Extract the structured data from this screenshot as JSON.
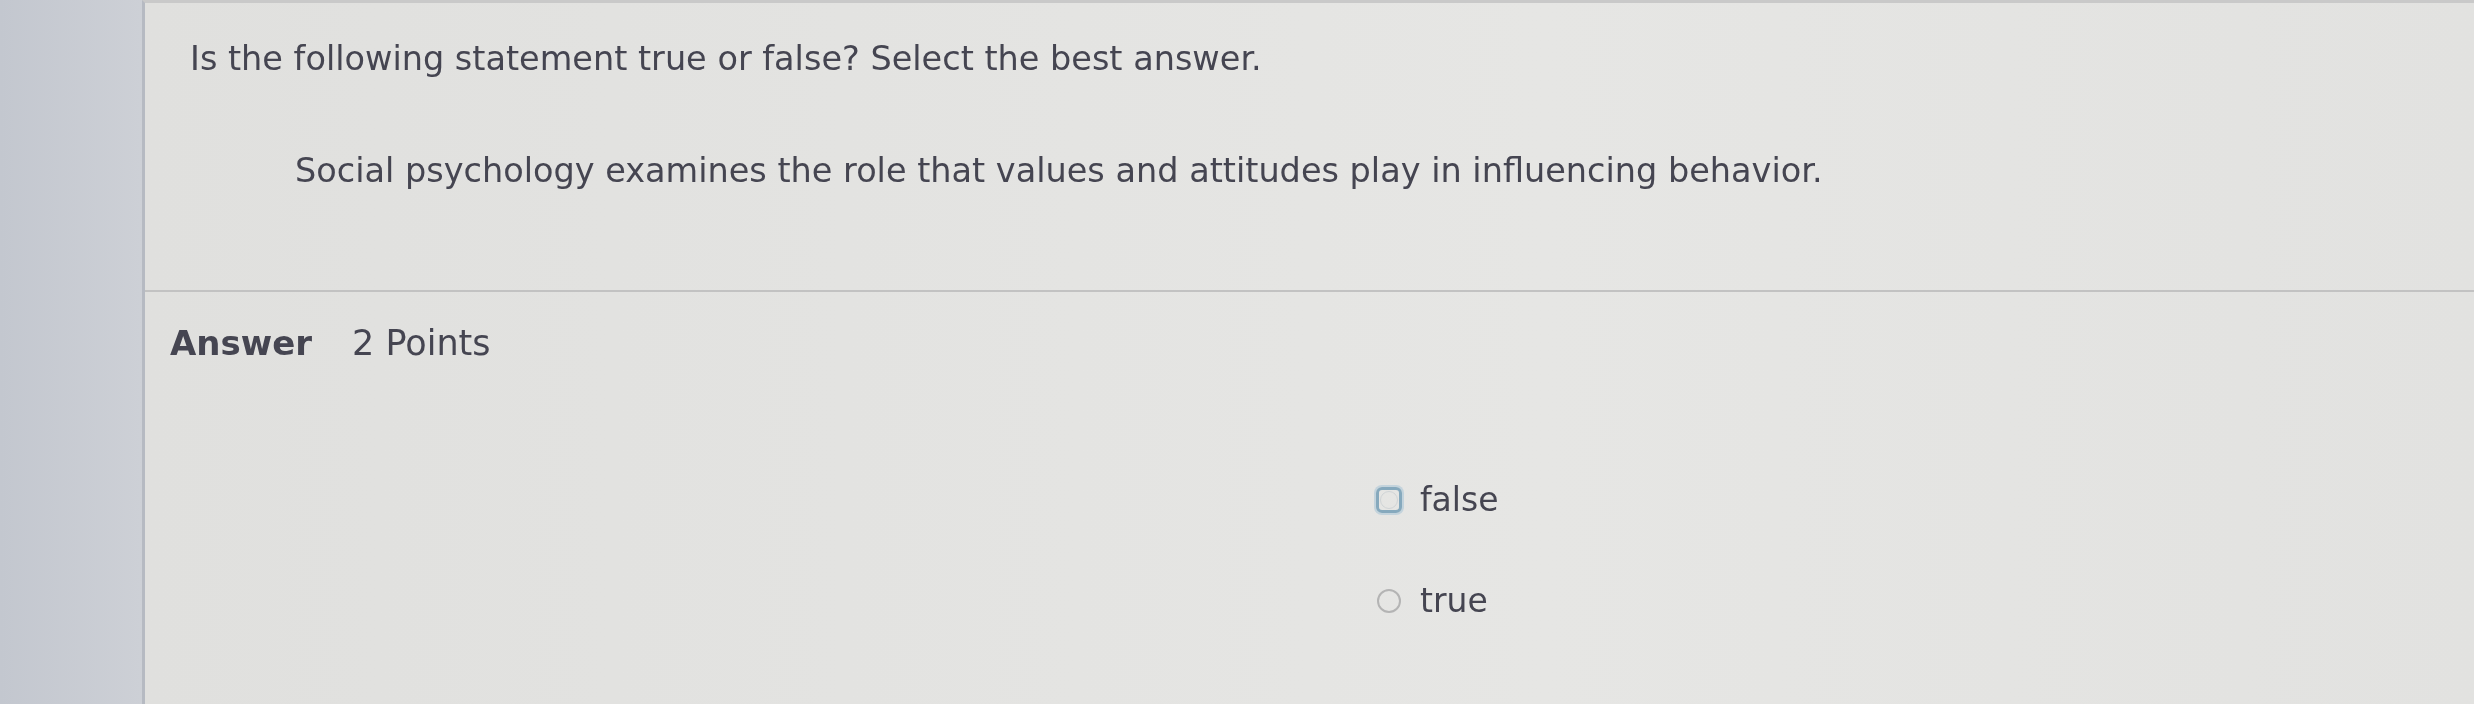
{
  "question": {
    "prompt": "Is the following statement true or false? Select the best answer.",
    "statement": "Social psychology examines the role that values and attitudes play in influencing behavior."
  },
  "answer": {
    "label": "Answer",
    "points": "2 Points",
    "options": [
      {
        "label": "false",
        "selected": false,
        "focused": true
      },
      {
        "label": "true",
        "selected": false,
        "focused": false
      }
    ]
  }
}
